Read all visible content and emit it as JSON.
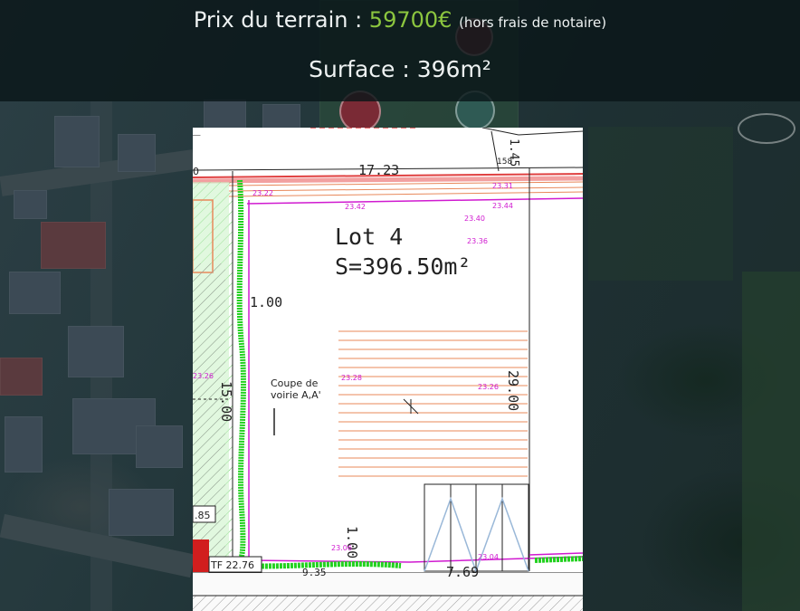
{
  "header": {
    "price_label": "Prix du terrain : ",
    "price_value": "59700€",
    "price_note": "(hors frais de notaire)",
    "surface_label": "Surface : 396m²"
  },
  "colors": {
    "price_accent": "#8cc63f",
    "banner_bg": "#0a1618",
    "plan_magenta": "#d01ad0",
    "plan_green": "#22d11f",
    "plan_orange": "#e8885a"
  },
  "plan": {
    "lot_title": "Lot 4",
    "lot_area": "S=396.50m²",
    "dim_top": "17.23",
    "dim_right_side": "29.00",
    "dim_left_side": "15.00",
    "dim_offset_left": "1.00",
    "dim_offset_bottom": "1.00",
    "dim_bottom": "7.69",
    "dim_top_right": "1.45",
    "dim_bottom_left": "9.35",
    "corner_label": "158",
    "cut_label_line1": "Coupe de",
    "cut_label_line2": "voirie A,A'",
    "ref_label": "TF 22.76",
    "side_box_label": ".85",
    "left_mark": "0",
    "point_levels": [
      "23.22",
      "23.42",
      "23.31",
      "23.44",
      "23.40",
      "23.36",
      "23.28",
      "23.26",
      "23.06",
      "23.04",
      "23.26"
    ]
  }
}
